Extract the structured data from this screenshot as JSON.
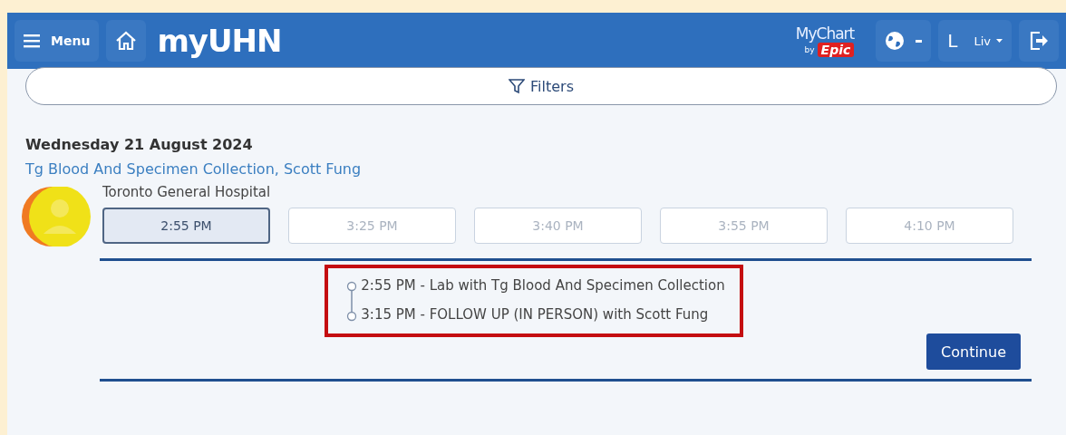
{
  "header": {
    "menu_label": "Menu",
    "brand": "my**UHN**",
    "partner_logo": {
      "name": "MyChart",
      "by": "by",
      "vendor": "Epic"
    },
    "user": {
      "initial": "L",
      "name": "Liv"
    }
  },
  "filters": {
    "label": "Filters"
  },
  "day": {
    "date": "Wednesday 21 August 2024",
    "providers_link": "Tg Blood And Specimen Collection, Scott Fung",
    "location": "Toronto General Hospital",
    "slots": [
      {
        "time": "2:55 PM",
        "selected": true
      },
      {
        "time": "3:25 PM",
        "selected": false
      },
      {
        "time": "3:40 PM",
        "selected": false
      },
      {
        "time": "3:55 PM",
        "selected": false
      },
      {
        "time": "4:10 PM",
        "selected": false
      }
    ],
    "summary": {
      "highlighted": true,
      "steps": [
        "2:55 PM - Lab with Tg Blood And Specimen Collection",
        "3:15 PM - FOLLOW UP (IN PERSON) with Scott Fung"
      ]
    },
    "action": "Continue"
  }
}
